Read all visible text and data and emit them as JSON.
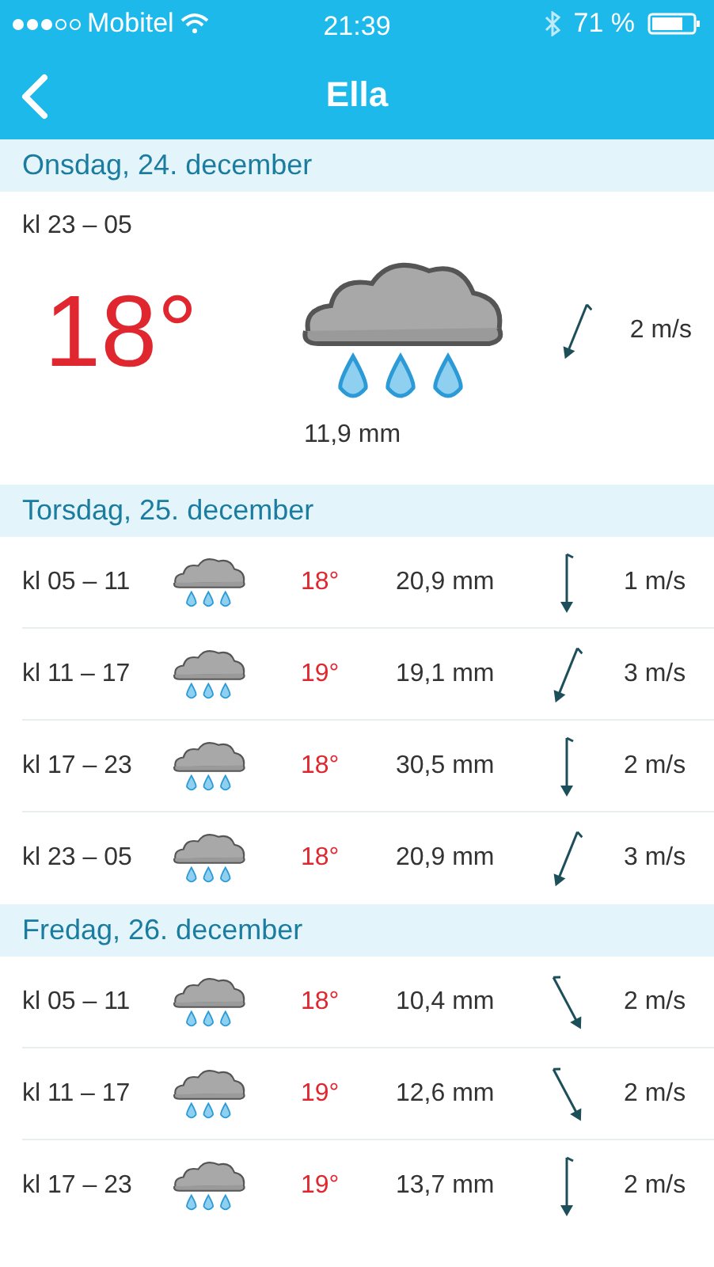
{
  "status_bar": {
    "carrier": "Mobitel",
    "time": "21:39",
    "battery": "71 %"
  },
  "nav": {
    "title": "Ella"
  },
  "days": [
    {
      "title": "Onsdag, 24. december",
      "kind": "featured",
      "periods": [
        {
          "time": "kl 23 – 05",
          "temp": "18°",
          "precip": "11,9 mm",
          "kind": "nne",
          "wind": "2 m/s"
        }
      ]
    },
    {
      "title": "Torsdag, 25. december",
      "kind": "list",
      "periods": [
        {
          "time": "kl 05 – 11",
          "temp": "18°",
          "precip": "20,9 mm",
          "kind": "n",
          "wind": "1 m/s"
        },
        {
          "time": "kl 11 – 17",
          "temp": "19°",
          "precip": "19,1 mm",
          "kind": "nne",
          "wind": "3 m/s"
        },
        {
          "time": "kl 17 – 23",
          "temp": "18°",
          "precip": "30,5 mm",
          "kind": "n",
          "wind": "2 m/s"
        },
        {
          "time": "kl 23 – 05",
          "temp": "18°",
          "precip": "20,9 mm",
          "kind": "nne",
          "wind": "3 m/s"
        }
      ]
    },
    {
      "title": "Fredag, 26. december",
      "kind": "list",
      "periods": [
        {
          "time": "kl 05 – 11",
          "temp": "18°",
          "precip": "10,4 mm",
          "kind": "nnw",
          "wind": "2 m/s"
        },
        {
          "time": "kl 11 – 17",
          "temp": "19°",
          "precip": "12,6 mm",
          "kind": "nnw",
          "wind": "2 m/s"
        },
        {
          "time": "kl 17 – 23",
          "temp": "19°",
          "precip": "13,7 mm",
          "kind": "n",
          "wind": "2 m/s"
        }
      ]
    }
  ]
}
